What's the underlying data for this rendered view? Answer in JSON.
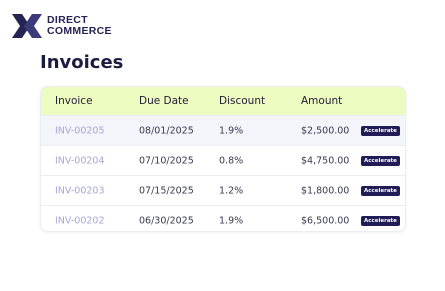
{
  "brand": {
    "line1": "DIRECT",
    "line2": "COMMERCE",
    "logo_icon": "direct-commerce-logo-icon"
  },
  "page_title": "Invoices",
  "table": {
    "columns": [
      "Invoice",
      "Due Date",
      "Discount",
      "Amount"
    ],
    "rows": [
      {
        "invoice": "INV-00205",
        "due": "08/01/2025",
        "discount": "1.9%",
        "amount": "$2,500.00",
        "action": "Accelerate"
      },
      {
        "invoice": "INV-00204",
        "due": "07/10/2025",
        "discount": "0.8%",
        "amount": "$4,750.00",
        "action": "Accelerate"
      },
      {
        "invoice": "INV-00203",
        "due": "07/15/2025",
        "discount": "1.2%",
        "amount": "$1,800.00",
        "action": "Accelerate"
      },
      {
        "invoice": "INV-00202",
        "due": "06/30/2025",
        "discount": "1.9%",
        "amount": "$6,500.00",
        "action": "Accelerate"
      }
    ]
  },
  "colors": {
    "header_bg": "#ecfcc0",
    "button_bg": "#1f1c56",
    "link": "#a6a7d6",
    "brand": "#262452"
  }
}
